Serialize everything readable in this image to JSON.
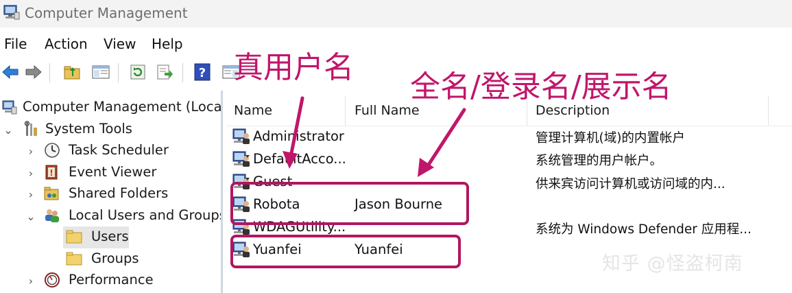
{
  "window": {
    "title": "Computer Management"
  },
  "menu": [
    "File",
    "Action",
    "View",
    "Help"
  ],
  "tree": {
    "root": "Computer Management (Local)",
    "system_tools": "System Tools",
    "task_scheduler": "Task Scheduler",
    "event_viewer": "Event Viewer",
    "shared_folders": "Shared Folders",
    "local_users_groups": "Local Users and Groups",
    "users": "Users",
    "groups": "Groups",
    "performance": "Performance"
  },
  "list": {
    "columns": [
      "Name",
      "Full Name",
      "Description"
    ],
    "rows": [
      {
        "name": "Administrator",
        "full_name": "",
        "description": "管理计算机(域)的内置帐户"
      },
      {
        "name": "DefaultAcco...",
        "full_name": "",
        "description": "系统管理的用户帐户。"
      },
      {
        "name": "Guest",
        "full_name": "",
        "description": "供来宾访问计算机或访问域的内..."
      },
      {
        "name": "Robota",
        "full_name": "Jason Bourne",
        "description": ""
      },
      {
        "name": "WDAGUtility...",
        "full_name": "",
        "description": "系统为 Windows Defender 应用程..."
      },
      {
        "name": "Yuanfei",
        "full_name": "Yuanfei",
        "description": ""
      }
    ]
  },
  "annotations": {
    "real_username": "真用户名",
    "display_name": "全名/登录名/展示名",
    "color": "#c0166a"
  },
  "watermark": "知乎 @怪盗柯南"
}
